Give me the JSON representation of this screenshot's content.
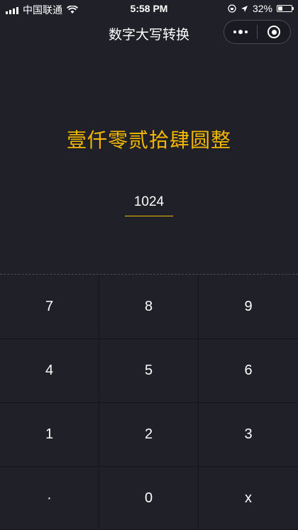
{
  "status_bar": {
    "carrier": "中国联通",
    "time": "5:58 PM",
    "battery_percent": "32%",
    "battery_level": 0.32,
    "icons": [
      "signal-icon",
      "wifi-icon",
      "lock-rotation-icon",
      "location-arrow-icon",
      "battery-icon"
    ]
  },
  "nav": {
    "title": "数字大写转换",
    "more_icon": "more-dots-icon",
    "close_icon": "close-ring-icon"
  },
  "converter": {
    "result": "壹仟零贰拾肆圆整",
    "input_value": "1024",
    "accent_color": "#f5b800"
  },
  "keypad": {
    "keys": [
      "7",
      "8",
      "9",
      "4",
      "5",
      "6",
      "1",
      "2",
      "3",
      "·",
      "0",
      "x"
    ]
  }
}
